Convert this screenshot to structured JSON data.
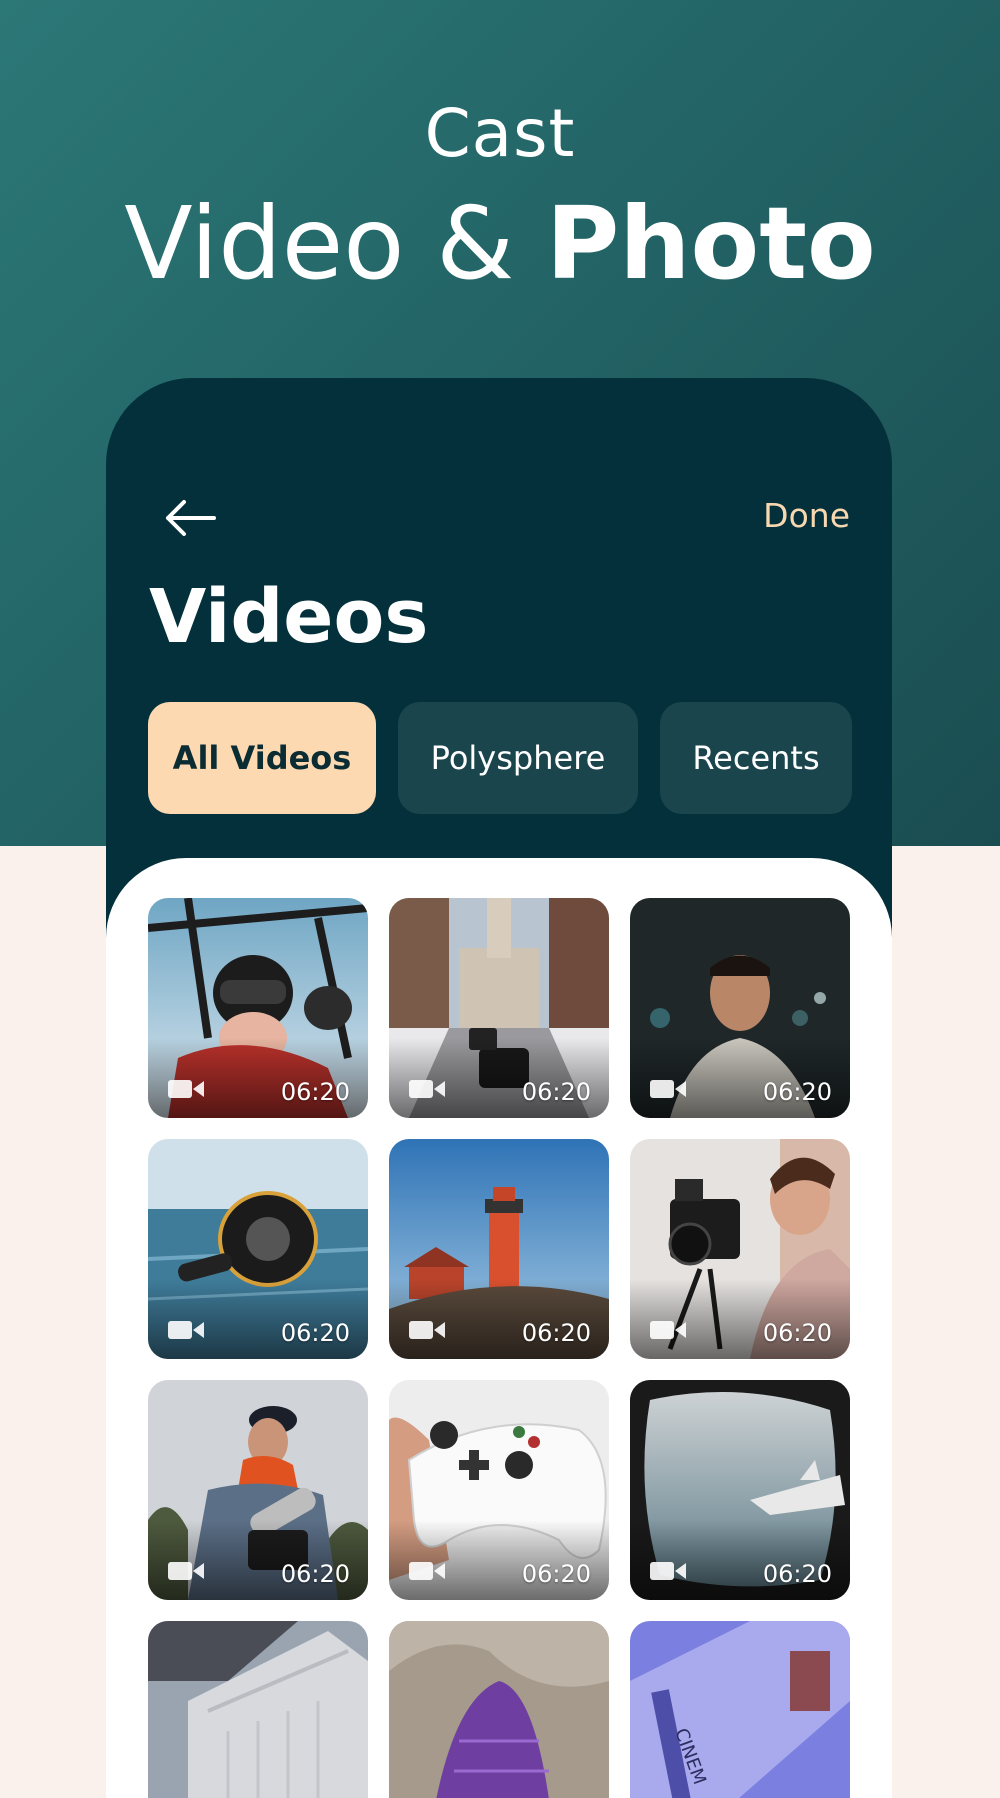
{
  "headline": {
    "line1": "Cast",
    "line2_regular": "Video & ",
    "line2_bold": "Photo"
  },
  "header": {
    "done_label": "Done",
    "title": "Videos"
  },
  "tabs": [
    {
      "label": "All Videos",
      "active": true
    },
    {
      "label": "Polysphere",
      "active": false
    },
    {
      "label": "Recents",
      "active": false
    }
  ],
  "videos": [
    {
      "duration": "06:20",
      "subject": "offroad-rider"
    },
    {
      "duration": "06:20",
      "subject": "city-hall-camera"
    },
    {
      "duration": "06:20",
      "subject": "portrait-man"
    },
    {
      "duration": "06:20",
      "subject": "underwater-housing"
    },
    {
      "duration": "06:20",
      "subject": "lighthouse"
    },
    {
      "duration": "06:20",
      "subject": "cinema-camera-operator"
    },
    {
      "duration": "06:20",
      "subject": "sound-recordist"
    },
    {
      "duration": "06:20",
      "subject": "game-controller"
    },
    {
      "duration": "06:20",
      "subject": "airplane-window"
    },
    {
      "duration": "",
      "subject": "building-corner"
    },
    {
      "duration": "",
      "subject": "purple-net"
    },
    {
      "duration": "",
      "subject": "cinema-facade"
    }
  ],
  "colors": {
    "accent": "#fdd9b1",
    "panel": "#03303a",
    "tab_inactive": "#1a454d",
    "background": "#faf1ec",
    "header_gradient": [
      "#2c7877",
      "#1a4d51"
    ]
  },
  "icons": {
    "back": "arrow-left-icon",
    "video": "video-camera-icon"
  }
}
